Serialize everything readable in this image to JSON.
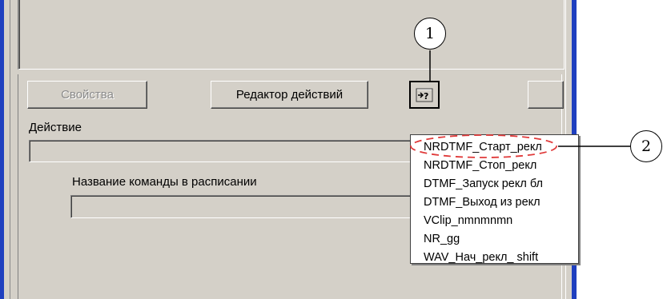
{
  "toolbar": {
    "properties_label": "Свойства",
    "action_editor_label": "Редактор действий",
    "right_button_label": ""
  },
  "action": {
    "label": "Действие",
    "value": ""
  },
  "schedule_command": {
    "label": "Название команды в расписании",
    "value": ""
  },
  "dropdown_menu": {
    "items": [
      "NRDTMF_Старт_рекл",
      "NRDTMF_Стоп_рекл",
      "DTMF_Запуск рекл бл",
      "DTMF_Выход из рекл",
      "VClip_nmnmnmn",
      "NR_gg",
      "WAV_Нач_рекл_ shift"
    ],
    "highlighted_index": 0
  },
  "callouts": {
    "one": "1",
    "two": "2"
  },
  "icons": {
    "insert_command_button": "insert-command-icon"
  },
  "colors": {
    "window_border_blue": "#1f3fbf",
    "dialog_gray": "#d4d0c8",
    "highlight_dash": "#e03a3a"
  }
}
